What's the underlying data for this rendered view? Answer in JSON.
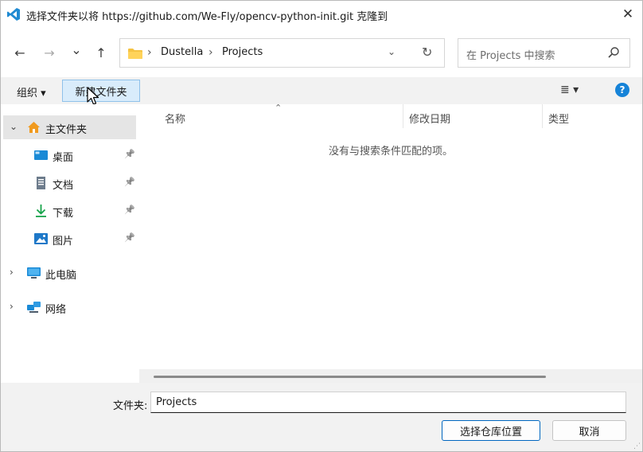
{
  "titlebar": {
    "title": "选择文件夹以将 https://github.com/We-Fly/opencv-python-init.git 克隆到",
    "close_glyph": "✕",
    "app_icon": "vscode-icon"
  },
  "nav": {
    "back_glyph": "←",
    "forward_glyph": "→",
    "recent_glyph": "⌄",
    "up_glyph": "↑",
    "breadcrumbs": [
      "Dustella",
      "Projects"
    ],
    "crumb_separator": "›",
    "dropdown_glyph": "⌄",
    "refresh_glyph": "↻",
    "search_placeholder": "在 Projects 中搜索"
  },
  "commandbar": {
    "organize_label": "组织 ▾",
    "new_folder_label": "新建文件夹",
    "view_label": "≣ ▾",
    "help_glyph": "?"
  },
  "sidebar": {
    "items": [
      {
        "label": "主文件夹",
        "icon": "home-icon",
        "chevron": "⌄",
        "selected": true
      },
      {
        "label": "桌面",
        "icon": "desktop-icon",
        "pinned": true
      },
      {
        "label": "文档",
        "icon": "document-icon",
        "pinned": true
      },
      {
        "label": "下载",
        "icon": "download-icon",
        "pinned": true
      },
      {
        "label": "图片",
        "icon": "pictures-icon",
        "pinned": true
      },
      {
        "label": "此电脑",
        "icon": "computer-icon",
        "chevron": "›"
      },
      {
        "label": "网络",
        "icon": "network-icon",
        "chevron": "›"
      }
    ],
    "pin_glyph": "📌"
  },
  "content": {
    "columns": [
      "名称",
      "修改日期",
      "类型"
    ],
    "sort_glyph": "⌃",
    "empty_message": "没有与搜索条件匹配的项。"
  },
  "footer": {
    "folder_label": "文件夹:",
    "folder_value": "Projects",
    "select_button": "选择仓库位置",
    "cancel_button": "取消"
  },
  "colors": {
    "accent": "#0067c0",
    "selection": "#d9ecfb",
    "help": "#1683d8",
    "folder": "#f5c342"
  }
}
